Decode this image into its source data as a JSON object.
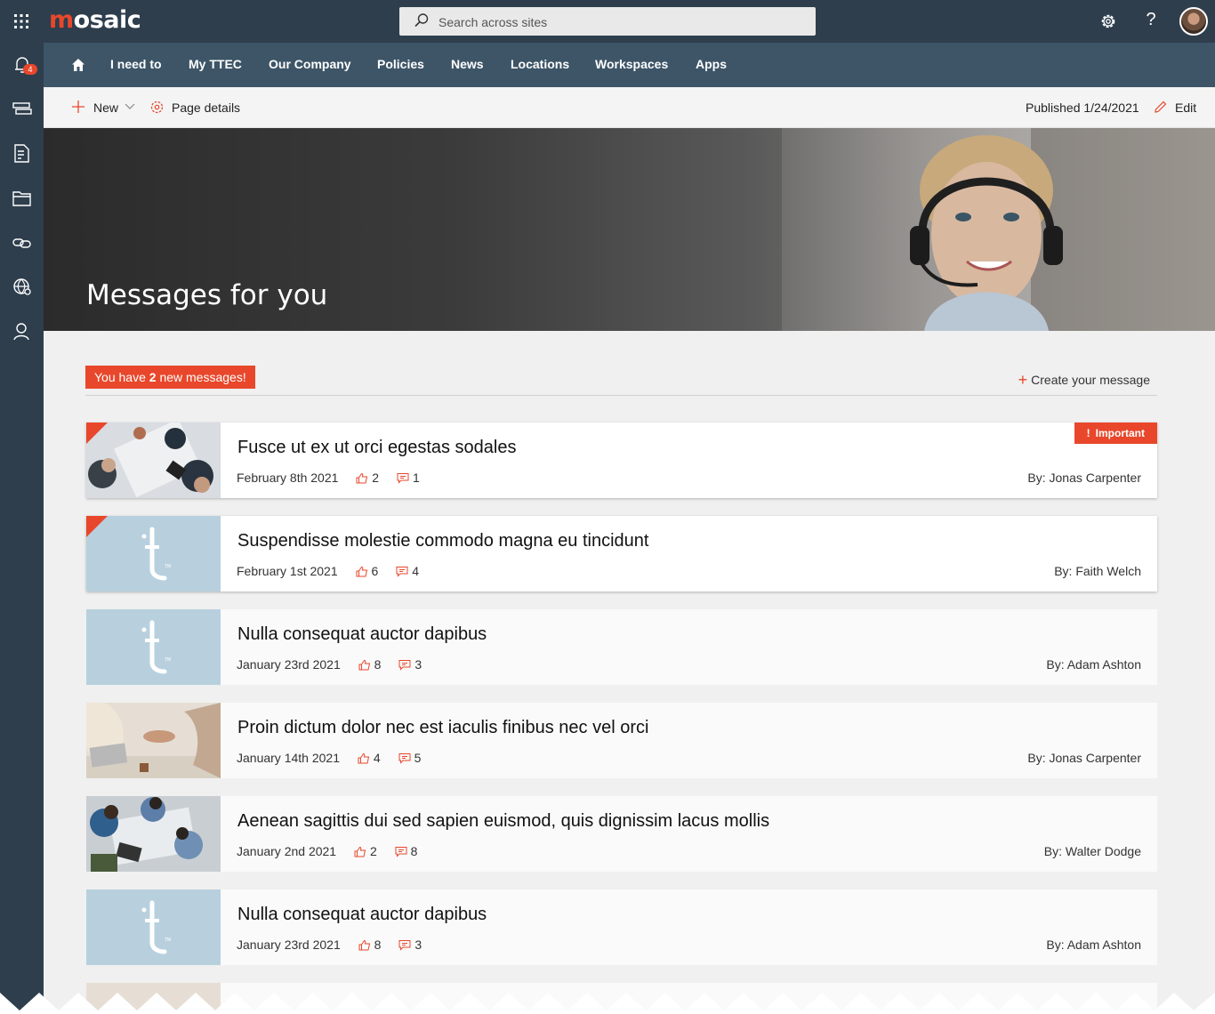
{
  "topbar": {
    "logo_prefix": "m",
    "logo_rest": "osaic",
    "search_placeholder": "Search across sites",
    "icons": [
      "app-launcher-icon",
      "search-icon",
      "settings-icon",
      "help-icon",
      "avatar"
    ]
  },
  "leftrail": {
    "notification_count": "4",
    "icons": [
      "bell-icon",
      "news-icon",
      "document-icon",
      "folder-icon",
      "link-icon",
      "globe-search-icon",
      "person-icon"
    ]
  },
  "nav": {
    "items": [
      "I need to",
      "My TTEC",
      "Our Company",
      "Policies",
      "News",
      "Locations",
      "Workspaces",
      "Apps"
    ]
  },
  "cmdbar": {
    "new_label": "New",
    "page_details_label": "Page details",
    "published_label": "Published 1/24/2021",
    "edit_label": "Edit"
  },
  "hero": {
    "title": "Messages for you"
  },
  "messages_header": {
    "prefix": "You have ",
    "count": "2",
    "suffix": " new messages!",
    "create_label": "Create your message"
  },
  "messages": [
    {
      "title": "Fusce ut ex ut orci egestas sodales",
      "date": "February 8th 2021",
      "likes": "2",
      "comments": "1",
      "author": "By: Jonas Carpenter",
      "important": "Important",
      "unread": true,
      "thumb": "meeting-photo"
    },
    {
      "title": "Suspendisse molestie commodo magna eu tincidunt",
      "date": "February 1st 2021",
      "likes": "6",
      "comments": "4",
      "author": "By: Faith Welch",
      "unread": true,
      "thumb": "ttec-logo"
    },
    {
      "title": "Nulla consequat auctor dapibus",
      "date": "January 23rd 2021",
      "likes": "8",
      "comments": "3",
      "author": "By: Adam Ashton",
      "unread": false,
      "thumb": "ttec-logo"
    },
    {
      "title": "Proin dictum dolor nec est iaculis finibus nec vel orci",
      "date": "January 14th 2021",
      "likes": "4",
      "comments": "5",
      "author": "By: Jonas Carpenter",
      "unread": false,
      "thumb": "handshake-photo"
    },
    {
      "title": "Aenean sagittis dui sed sapien euismod, quis dignissim lacus mollis",
      "date": "January 2nd 2021",
      "likes": "2",
      "comments": "8",
      "author": "By: Walter Dodge",
      "unread": false,
      "thumb": "team-photo"
    },
    {
      "title": "Nulla consequat auctor dapibus",
      "date": "January 23rd 2021",
      "likes": "8",
      "comments": "3",
      "author": "By: Adam Ashton",
      "unread": false,
      "thumb": "ttec-logo"
    }
  ],
  "colors": {
    "accent": "#e8472b",
    "topbar": "#2e3e4d",
    "nav": "#3d5567"
  }
}
